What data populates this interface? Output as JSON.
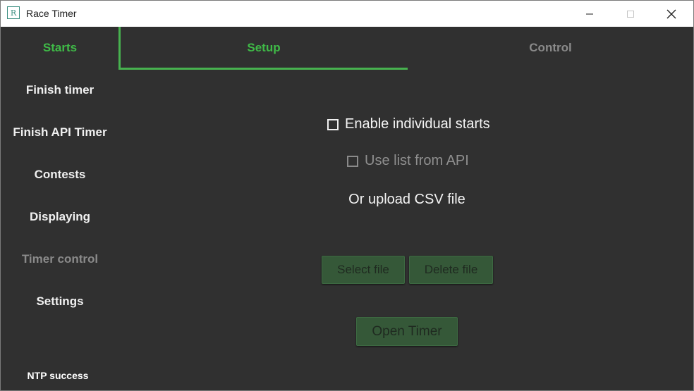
{
  "window": {
    "title": "Race Timer",
    "icon_letter": "R",
    "controls": [
      "minimize-icon",
      "maximize-icon",
      "close-icon"
    ]
  },
  "sidebar": {
    "items": [
      {
        "label": "Starts",
        "state": "active"
      },
      {
        "label": "Finish timer",
        "state": "normal"
      },
      {
        "label": "Finish API Timer",
        "state": "normal"
      },
      {
        "label": "Contests",
        "state": "normal"
      },
      {
        "label": "Displaying",
        "state": "normal"
      },
      {
        "label": "Timer control",
        "state": "disabled"
      },
      {
        "label": "Settings",
        "state": "normal"
      }
    ],
    "status": "NTP success"
  },
  "tabs": [
    {
      "label": "Setup",
      "state": "selected"
    },
    {
      "label": "Control",
      "state": "disabled"
    }
  ],
  "setup": {
    "enable_individual": {
      "label": "Enable individual starts",
      "checked": false
    },
    "use_api_list": {
      "label": "Use list from API",
      "checked": false,
      "disabled": true
    },
    "csv_label": "Or upload CSV file",
    "select_file": "Select file",
    "delete_file": "Delete file",
    "open_timer": "Open Timer"
  },
  "colors": {
    "accent": "#47b24f",
    "background": "#303030",
    "button": "#355838"
  }
}
